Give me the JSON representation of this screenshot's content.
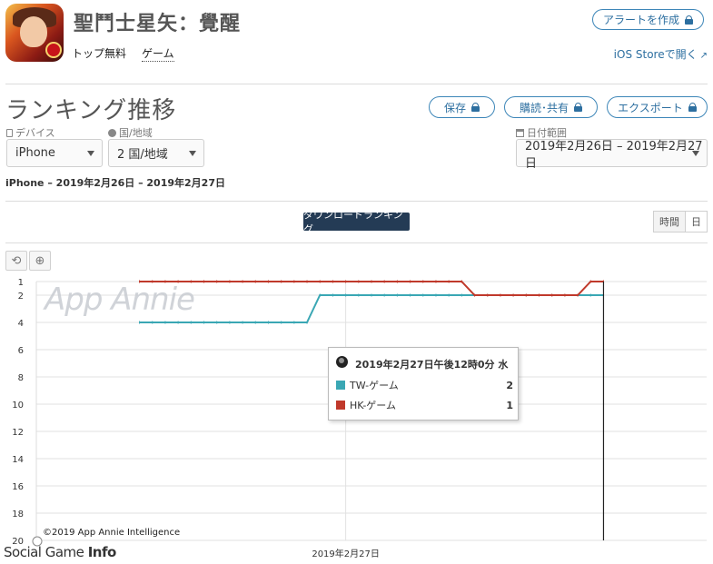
{
  "app": {
    "title": "聖鬥士星矢：覺醒",
    "category_rank": "トップ無料",
    "category": "ゲーム",
    "icon": "app-icon-saint-seiya"
  },
  "header_actions": {
    "alert_label": "アラートを作成",
    "ios_store_label": "iOS Storeで開く"
  },
  "section": {
    "title": "ランキング推移",
    "save_label": "保存",
    "subscribe_label": "購読･共有",
    "export_label": "エクスポート"
  },
  "filters": {
    "device_label": "デバイス",
    "device_value": "iPhone",
    "country_label": "国/地域",
    "country_value": "2 国/地域",
    "date_label": "日付範囲",
    "date_value": "2019年2月26日 – 2019年2月27日"
  },
  "subtitle": "iPhone – 2019年2月26日 – 2019年2月27日",
  "chart_controls": {
    "download_ranking_label": "ダウンロードランキング",
    "granularity_hour": "時間",
    "granularity_day": "日",
    "reset_icon": "undo-icon",
    "zoom_icon": "zoom-in-icon"
  },
  "tooltip": {
    "title": "2019年2月27日午後12時0分 水",
    "rows": [
      {
        "name": "TW-ゲーム",
        "value": "2",
        "color": "#3aa7b4"
      },
      {
        "name": "HK-ゲーム",
        "value": "1",
        "color": "#c0392b"
      }
    ]
  },
  "watermark": "App Annie",
  "copyright": "©2019 App Annie Intelligence",
  "footer_brand": {
    "a": "Social Game",
    "b": "Info"
  },
  "colors": {
    "accent": "#2d6fa0",
    "tw": "#3aa7b4",
    "hk": "#c0392b",
    "button_dark": "#243b55"
  },
  "chart_data": {
    "type": "line",
    "title": "",
    "xlabel": "",
    "ylabel": "",
    "y_reversed": true,
    "ylim": [
      1,
      20
    ],
    "yticks": [
      1,
      2,
      4,
      6,
      8,
      10,
      12,
      14,
      16,
      18,
      20
    ],
    "x_tick_label": "2019年2月27日",
    "x_hours": [
      0,
      1,
      2,
      3,
      4,
      5,
      6,
      7,
      8,
      9,
      10,
      11,
      12,
      13,
      14,
      15,
      16,
      17,
      18,
      19,
      20,
      21,
      22,
      23,
      24,
      25,
      26,
      27,
      28,
      29,
      30,
      31,
      32,
      33,
      34,
      35,
      36
    ],
    "x_range_hours": [
      -8,
      44
    ],
    "x_tick_hour": 16,
    "cursor_hour": 36,
    "series": [
      {
        "name": "TW-ゲーム",
        "color": "#3aa7b4",
        "values": [
          4,
          4,
          4,
          4,
          4,
          4,
          4,
          4,
          4,
          4,
          4,
          4,
          4,
          4,
          2,
          2,
          2,
          2,
          2,
          2,
          2,
          2,
          2,
          2,
          2,
          2,
          2,
          2,
          2,
          2,
          2,
          2,
          2,
          2,
          2,
          2,
          2
        ]
      },
      {
        "name": "HK-ゲーム",
        "color": "#c0392b",
        "values": [
          1,
          1,
          1,
          1,
          1,
          1,
          1,
          1,
          1,
          1,
          1,
          1,
          1,
          1,
          1,
          1,
          1,
          1,
          1,
          1,
          1,
          1,
          1,
          1,
          1,
          1,
          2,
          2,
          2,
          2,
          2,
          2,
          2,
          2,
          2,
          1,
          1
        ]
      }
    ]
  }
}
